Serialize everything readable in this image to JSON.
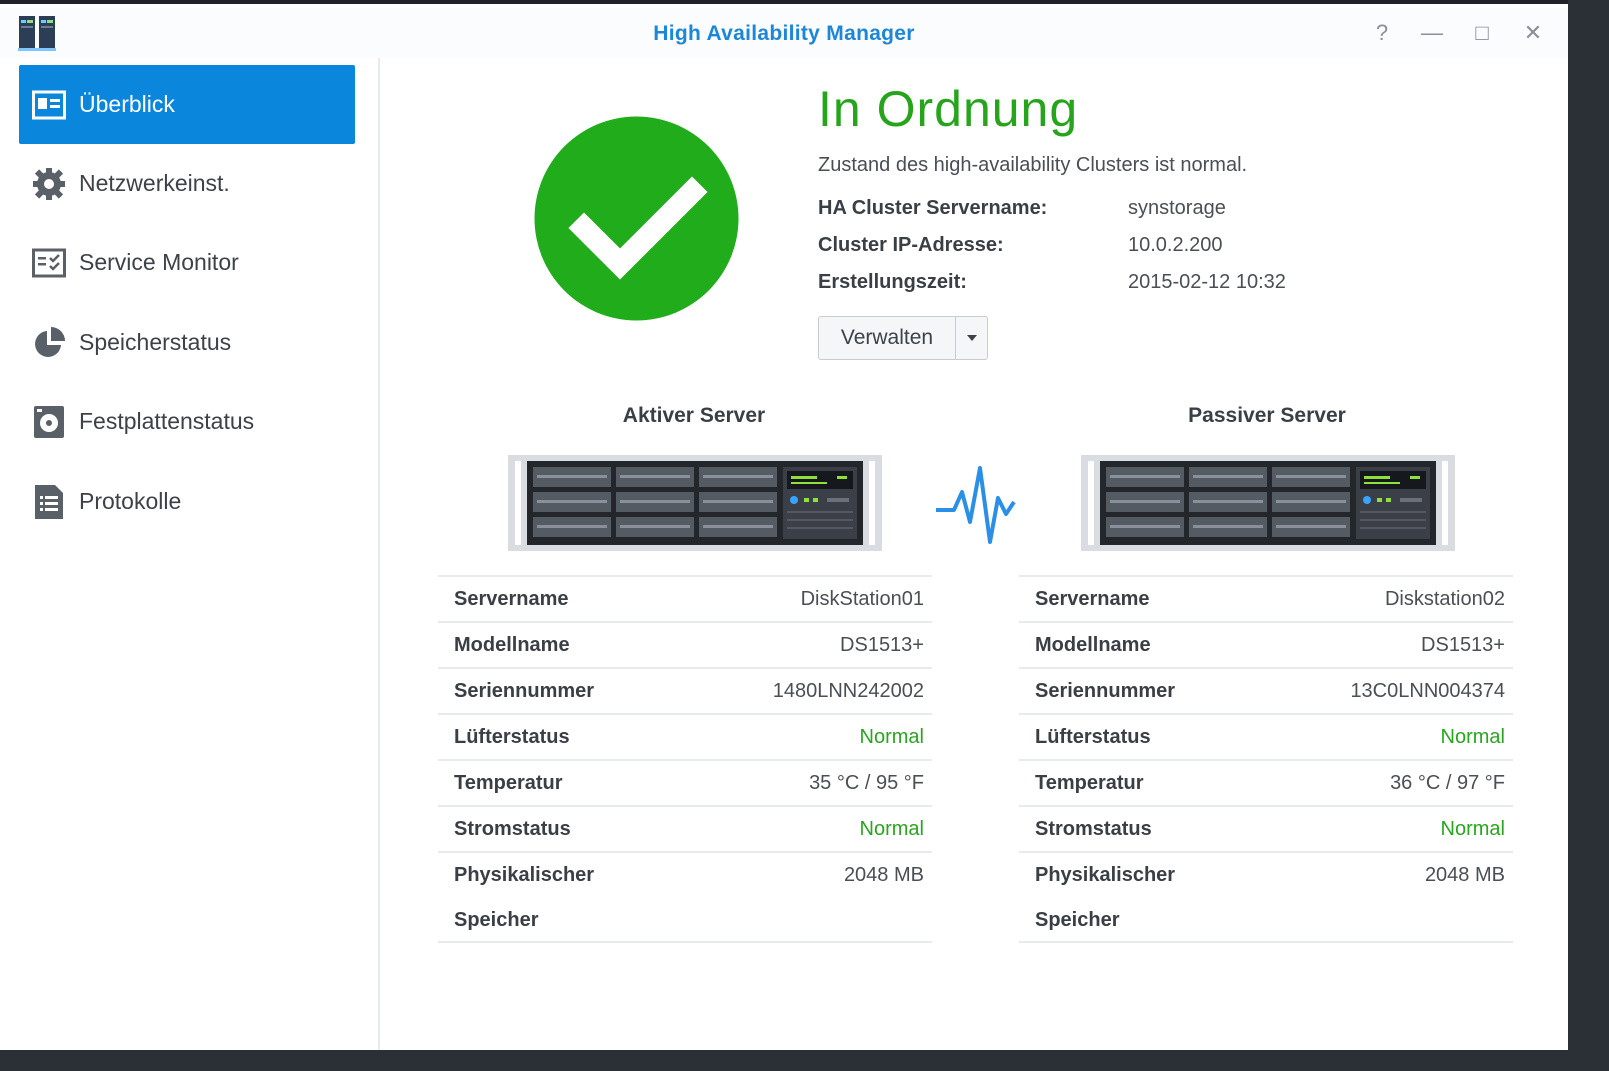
{
  "window": {
    "title": "High Availability Manager",
    "help_glyph": "?",
    "minimize_glyph": "—",
    "maximize_glyph": "□",
    "close_glyph": "✕"
  },
  "sidebar": {
    "items": [
      {
        "label": "Überblick",
        "icon": "overview-card-icon",
        "active": true
      },
      {
        "label": "Netzwerkeinst.",
        "icon": "gear-icon"
      },
      {
        "label": "Service Monitor",
        "icon": "service-monitor-icon"
      },
      {
        "label": "Speicherstatus",
        "icon": "pie-chart-icon"
      },
      {
        "label": "Festplattenstatus",
        "icon": "disk-icon"
      },
      {
        "label": "Protokolle",
        "icon": "log-list-icon"
      }
    ]
  },
  "overview": {
    "status_title": "In Ordnung",
    "status_description": "Zustand des high-availability Clusters ist normal.",
    "fields": [
      {
        "label": "HA Cluster Servername:",
        "value": "synstorage"
      },
      {
        "label": "Cluster IP-Adresse:",
        "value": "10.0.2.200"
      },
      {
        "label": "Erstellungszeit:",
        "value": "2015-02-12 10:32"
      }
    ],
    "manage_button": "Verwalten"
  },
  "colors": {
    "accent": "#0b86dd",
    "status_ok": "#26a51c",
    "title_blue": "#1c86d8"
  },
  "servers": {
    "active": {
      "title": "Aktiver Server",
      "rows": [
        {
          "label": "Servername",
          "value": "DiskStation01"
        },
        {
          "label": "Modellname",
          "value": "DS1513+"
        },
        {
          "label": "Seriennummer",
          "value": "1480LNN242002"
        },
        {
          "label": "Lüfterstatus",
          "value": "Normal",
          "ok": true
        },
        {
          "label": "Temperatur",
          "value": "35 °C / 95 °F"
        },
        {
          "label": "Stromstatus",
          "value": "Normal",
          "ok": true
        },
        {
          "label": "Physikalischer Speicher",
          "value": "2048 MB"
        }
      ]
    },
    "passive": {
      "title": "Passiver Server",
      "rows": [
        {
          "label": "Servername",
          "value": "Diskstation02"
        },
        {
          "label": "Modellname",
          "value": "DS1513+"
        },
        {
          "label": "Seriennummer",
          "value": "13C0LNN004374"
        },
        {
          "label": "Lüfterstatus",
          "value": "Normal",
          "ok": true
        },
        {
          "label": "Temperatur",
          "value": "36 °C / 97 °F"
        },
        {
          "label": "Stromstatus",
          "value": "Normal",
          "ok": true
        },
        {
          "label": "Physikalischer Speicher",
          "value": "2048 MB"
        }
      ]
    }
  }
}
